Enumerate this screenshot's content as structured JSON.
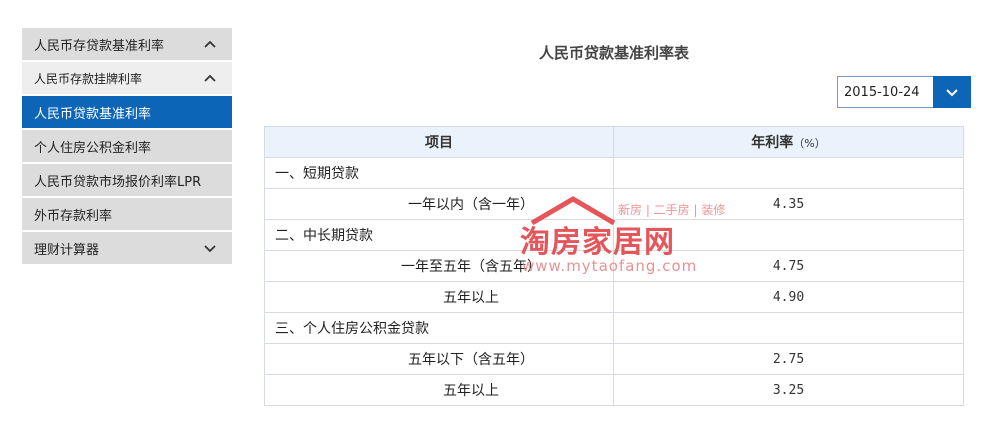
{
  "sidebar": {
    "items": [
      {
        "label": "人民币存贷款基准利率",
        "chevron": "up"
      },
      {
        "label": "人民币存款挂牌利率",
        "chevron": "up"
      },
      {
        "label": "人民币贷款基准利率",
        "chevron": ""
      },
      {
        "label": "个人住房公积金利率",
        "chevron": ""
      },
      {
        "label": "人民币贷款市场报价利率LPR",
        "chevron": ""
      },
      {
        "label": "外币存款利率",
        "chevron": ""
      },
      {
        "label": "理财计算器",
        "chevron": "down"
      }
    ]
  },
  "page": {
    "title": "人民币贷款基准利率表"
  },
  "date_select": {
    "value": "2015-10-24"
  },
  "table": {
    "headers": {
      "item": "项目",
      "rate": "年利率",
      "unit": "（%）"
    },
    "rows": [
      {
        "item": "一、短期贷款",
        "rate": "",
        "type": "cat"
      },
      {
        "item": "一年以内（含一年）",
        "rate": "4.35",
        "type": "sub"
      },
      {
        "item": "二、中长期贷款",
        "rate": "",
        "type": "cat"
      },
      {
        "item": "一年至五年（含五年）",
        "rate": "4.75",
        "type": "sub"
      },
      {
        "item": "五年以上",
        "rate": "4.90",
        "type": "sub"
      },
      {
        "item": "三、个人住房公积金贷款",
        "rate": "",
        "type": "cat"
      },
      {
        "item": "五年以下（含五年）",
        "rate": "2.75",
        "type": "sub"
      },
      {
        "item": "五年以上",
        "rate": "3.25",
        "type": "sub"
      }
    ]
  },
  "watermark": {
    "logo": "淘房家居网",
    "tagline": "新房 | 二手房 | 装修",
    "url": "www.mytaofang.com"
  },
  "colors": {
    "accent": "#0d65b8",
    "header_bg": "#eaf3fb",
    "sidebar_bg": "#dcdcdc",
    "watermark": "#e3474b"
  }
}
